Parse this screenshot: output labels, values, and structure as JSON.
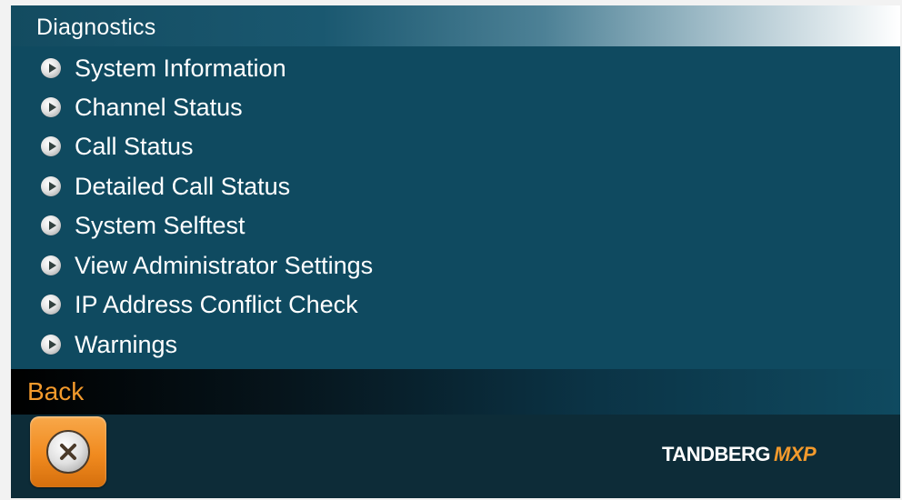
{
  "title": "Diagnostics",
  "menu": {
    "items": [
      {
        "label": "System Information",
        "icon": "play-bullet-icon"
      },
      {
        "label": "Channel Status",
        "icon": "play-bullet-icon"
      },
      {
        "label": "Call Status",
        "icon": "play-bullet-icon"
      },
      {
        "label": "Detailed Call Status",
        "icon": "play-bullet-icon"
      },
      {
        "label": "System Selftest",
        "icon": "play-bullet-icon"
      },
      {
        "label": "View Administrator Settings",
        "icon": "play-bullet-icon"
      },
      {
        "label": "IP Address Conflict Check",
        "icon": "play-bullet-icon"
      },
      {
        "label": "Warnings",
        "icon": "play-bullet-icon"
      }
    ]
  },
  "footer": {
    "back_label": "Back",
    "back_button_icon": "close-icon",
    "brand": "TANDBERG",
    "brand_suffix": "MXP"
  },
  "colors": {
    "background": "#0f4a60",
    "accent_orange": "#f39a2c",
    "text": "#ffffff"
  }
}
